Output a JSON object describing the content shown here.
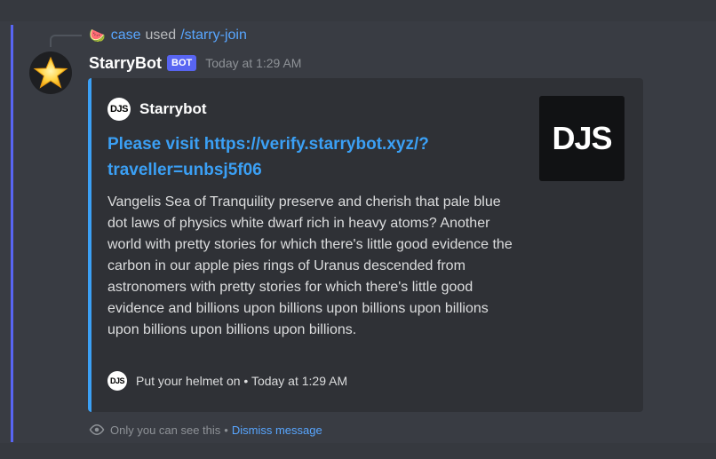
{
  "reply": {
    "emoji": "🍉",
    "user": "case",
    "used_text": "used",
    "command": "/starry-join"
  },
  "message": {
    "author": "StarryBot",
    "bot_tag": "BOT",
    "timestamp": "Today at 1:29 AM",
    "avatar_icon": "star-icon"
  },
  "embed": {
    "accent_color": "#3ba0f5",
    "author_icon_text": "DJS",
    "author_name": "Starrybot",
    "title": "Please visit https://verify.starrybot.xyz/?traveller=unbsj5f06",
    "description": "Vangelis Sea of Tranquility preserve and cherish that pale blue dot laws of physics white dwarf rich in heavy atoms? Another world with pretty stories for which there's little good evidence the carbon in our apple pies rings of Uranus descended from astronomers with pretty stories for which there's little good evidence and billions upon billions upon billions upon billions upon billions upon billions upon billions.",
    "thumbnail_text": "DJS",
    "footer_icon_text": "DJS",
    "footer_text": "Put your helmet on • Today at 1:29 AM"
  },
  "ephemeral": {
    "icon": "eye-icon",
    "note": "Only you can see this",
    "separator": "•",
    "dismiss_label": "Dismiss message"
  }
}
